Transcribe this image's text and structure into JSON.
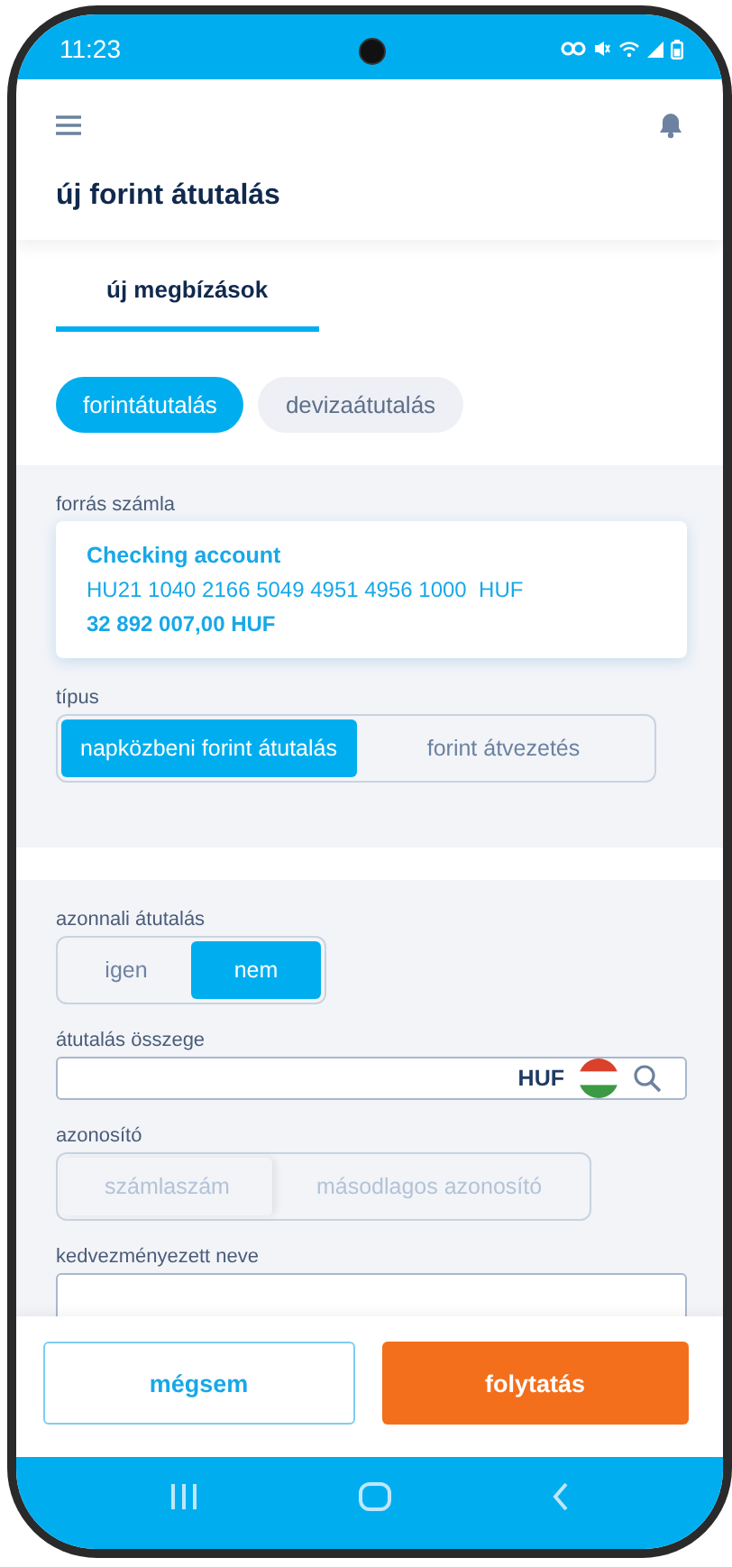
{
  "status_bar": {
    "time": "11:23"
  },
  "header": {
    "title": "új forint átutalás"
  },
  "tabs": [
    {
      "label": "új megbízások",
      "selected": true
    }
  ],
  "transfer_types": [
    {
      "label": "forintátutalás",
      "selected": true
    },
    {
      "label": "devizaátutalás",
      "selected": false
    }
  ],
  "source_account": {
    "label": "forrás számla",
    "name": "Checking account",
    "iban": "HU21 1040 2166 5049 4951 4956 1000  HUF",
    "balance": "32 892 007,00 HUF"
  },
  "type": {
    "label": "típus",
    "disabled": false,
    "options": [
      {
        "label": "napközbeni forint átutalás",
        "selected": true
      },
      {
        "label": "forint átvezetés",
        "selected": false
      }
    ]
  },
  "instant": {
    "label": "azonnali átutalás",
    "disabled": false,
    "options": [
      {
        "label": "igen",
        "selected": false
      },
      {
        "label": "nem",
        "selected": true
      }
    ]
  },
  "amount": {
    "label": "átutalás összege",
    "currency": "HUF"
  },
  "identifier": {
    "label": "azonosító",
    "disabled": true,
    "options": [
      {
        "label": "számlaszám",
        "selected": true
      },
      {
        "label": "másodlagos azonosító",
        "selected": false
      }
    ]
  },
  "beneficiary": {
    "label": "kedvezményezett neve"
  },
  "buttons": [
    {
      "label": "mégsem",
      "kind": "secondary"
    },
    {
      "label": "folytatás",
      "kind": "primary"
    }
  ]
}
